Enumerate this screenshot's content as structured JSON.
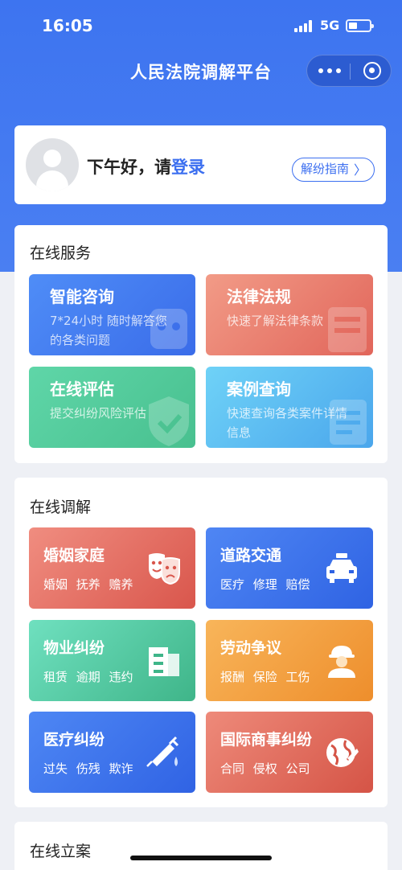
{
  "status_bar": {
    "time": "16:05",
    "network": "5G",
    "battery_level": 0.3
  },
  "nav": {
    "title": "人民法院调解平台",
    "icons": [
      "more-dots-icon",
      "target-icon"
    ]
  },
  "greeting": {
    "text": "下午好，请",
    "login_link": "登录",
    "guide_button": "解纷指南",
    "guide_chevron": "〉"
  },
  "online_services": {
    "title": "在线服务",
    "tiles": [
      {
        "title": "智能咨询",
        "desc": "7*24小时 随时解答您的各类问题",
        "color": "#3f78ee"
      },
      {
        "title": "法律法规",
        "desc": "快速了解法律条款",
        "color": "#e87a6c"
      },
      {
        "title": "在线评估",
        "desc": "提交纠纷风险评估",
        "color": "#52cb9b"
      },
      {
        "title": "案例查询",
        "desc": "快速查询各类案件详情信息",
        "color": "#5ab9f1"
      }
    ]
  },
  "online_mediation": {
    "title": "在线调解",
    "tiles": [
      {
        "title": "婚姻家庭",
        "tags": "婚姻 抚养 赡养",
        "icon": "masks-icon"
      },
      {
        "title": "道路交通",
        "tags": "医疗 修理 赔偿",
        "icon": "taxi-icon"
      },
      {
        "title": "物业纠纷",
        "tags": "租赁 逾期 违约",
        "icon": "building-icon"
      },
      {
        "title": "劳动争议",
        "tags": "报酬 保险 工伤",
        "icon": "worker-icon"
      },
      {
        "title": "医疗纠纷",
        "tags": "过失 伤残 欺诈",
        "icon": "syringe-icon"
      },
      {
        "title": "国际商事纠纷",
        "tags": "合同 侵权 公司",
        "icon": "globe-icon"
      }
    ]
  },
  "online_filing": {
    "title": "在线立案"
  }
}
